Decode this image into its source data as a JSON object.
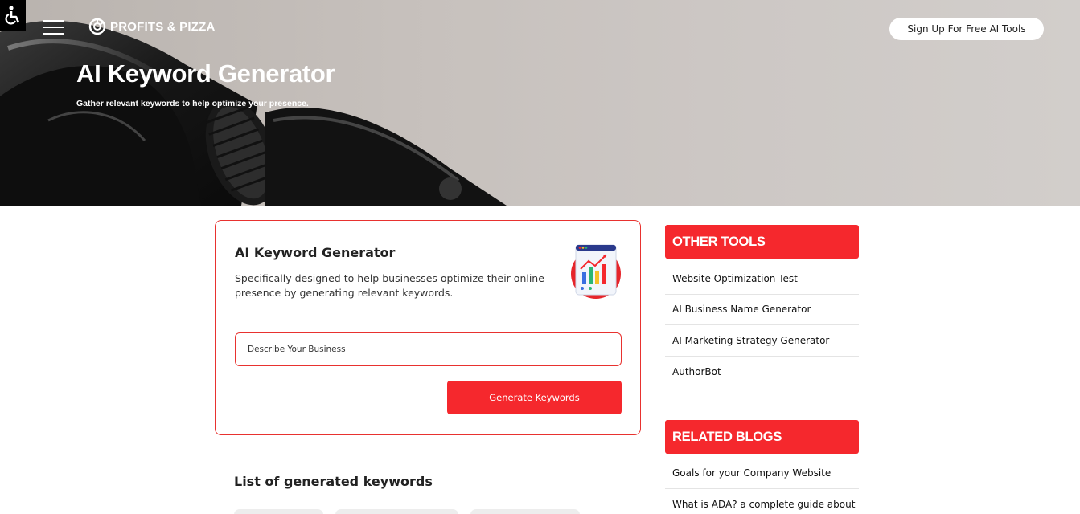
{
  "header": {
    "logo_text": "PROFITS & PIZZA",
    "signup_label": "Sign Up For Free AI Tools",
    "title": "AI Keyword Generator",
    "subtitle": "Gather relevant keywords to help optimize your presence."
  },
  "tool": {
    "title": "AI Keyword Generator",
    "description": "Specifically designed to help businesses optimize their online presence by generating relevant keywords.",
    "input_placeholder": "Describe Your Business",
    "button_label": "Generate Keywords"
  },
  "results": {
    "heading": "List of generated keywords"
  },
  "sidebar": {
    "other_tools_title": "OTHER TOOLS",
    "other_tools": [
      {
        "label": "Website Optimization Test"
      },
      {
        "label": "AI Business Name Generator"
      },
      {
        "label": "AI Marketing Strategy Generator"
      },
      {
        "label": "AuthorBot"
      }
    ],
    "related_blogs_title": "RELATED BLOGS",
    "related_blogs": [
      {
        "label": "Goals for your Company Website"
      },
      {
        "label": "What is ADA? a complete guide about"
      }
    ]
  },
  "colors": {
    "accent": "#f5282d",
    "border": "#e8322f"
  },
  "icons": [
    "accessibility-icon",
    "hamburger-menu-icon",
    "logo-icon",
    "keyword-chart-icon"
  ]
}
